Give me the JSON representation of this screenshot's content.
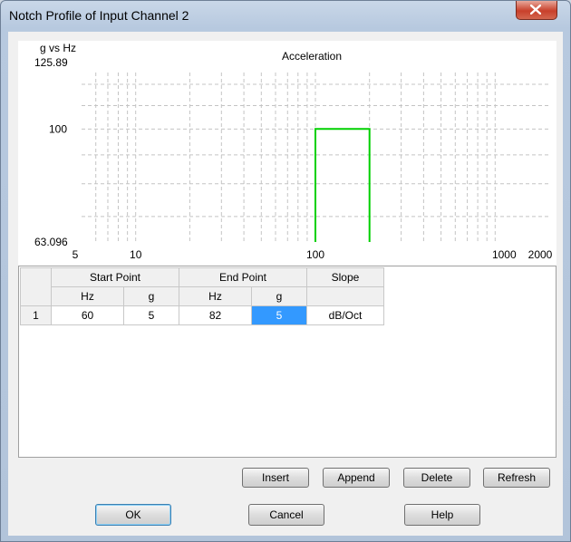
{
  "window": {
    "title": "Notch Profile of Input Channel 2"
  },
  "chart_data": {
    "type": "line",
    "title": "Acceleration",
    "ylabel": "g vs Hz",
    "xscale": "log",
    "yscale": "log",
    "xlim": [
      5,
      2000
    ],
    "ylim": [
      63.096,
      125.89
    ],
    "xticks": [
      "5",
      "10",
      "100",
      "1000",
      "2000"
    ],
    "yticks": [
      "125.89",
      "100",
      "63.096"
    ],
    "grid": true,
    "series": [
      {
        "color": "#00d000",
        "x": [
          100,
          100,
          200,
          200
        ],
        "y": [
          63.096,
          100,
          100,
          63.096
        ]
      }
    ]
  },
  "table": {
    "group_headers": [
      "Start Point",
      "End Point",
      "Slope"
    ],
    "sub_headers": [
      "Hz",
      "g",
      "Hz",
      "g",
      ""
    ],
    "rows": [
      {
        "index": "1",
        "cells": [
          "60",
          "5",
          "82",
          "5",
          "dB/Oct"
        ]
      }
    ]
  },
  "buttons": {
    "insert": "Insert",
    "append": "Append",
    "delete": "Delete",
    "refresh": "Refresh",
    "ok": "OK",
    "cancel": "Cancel",
    "help": "Help"
  }
}
